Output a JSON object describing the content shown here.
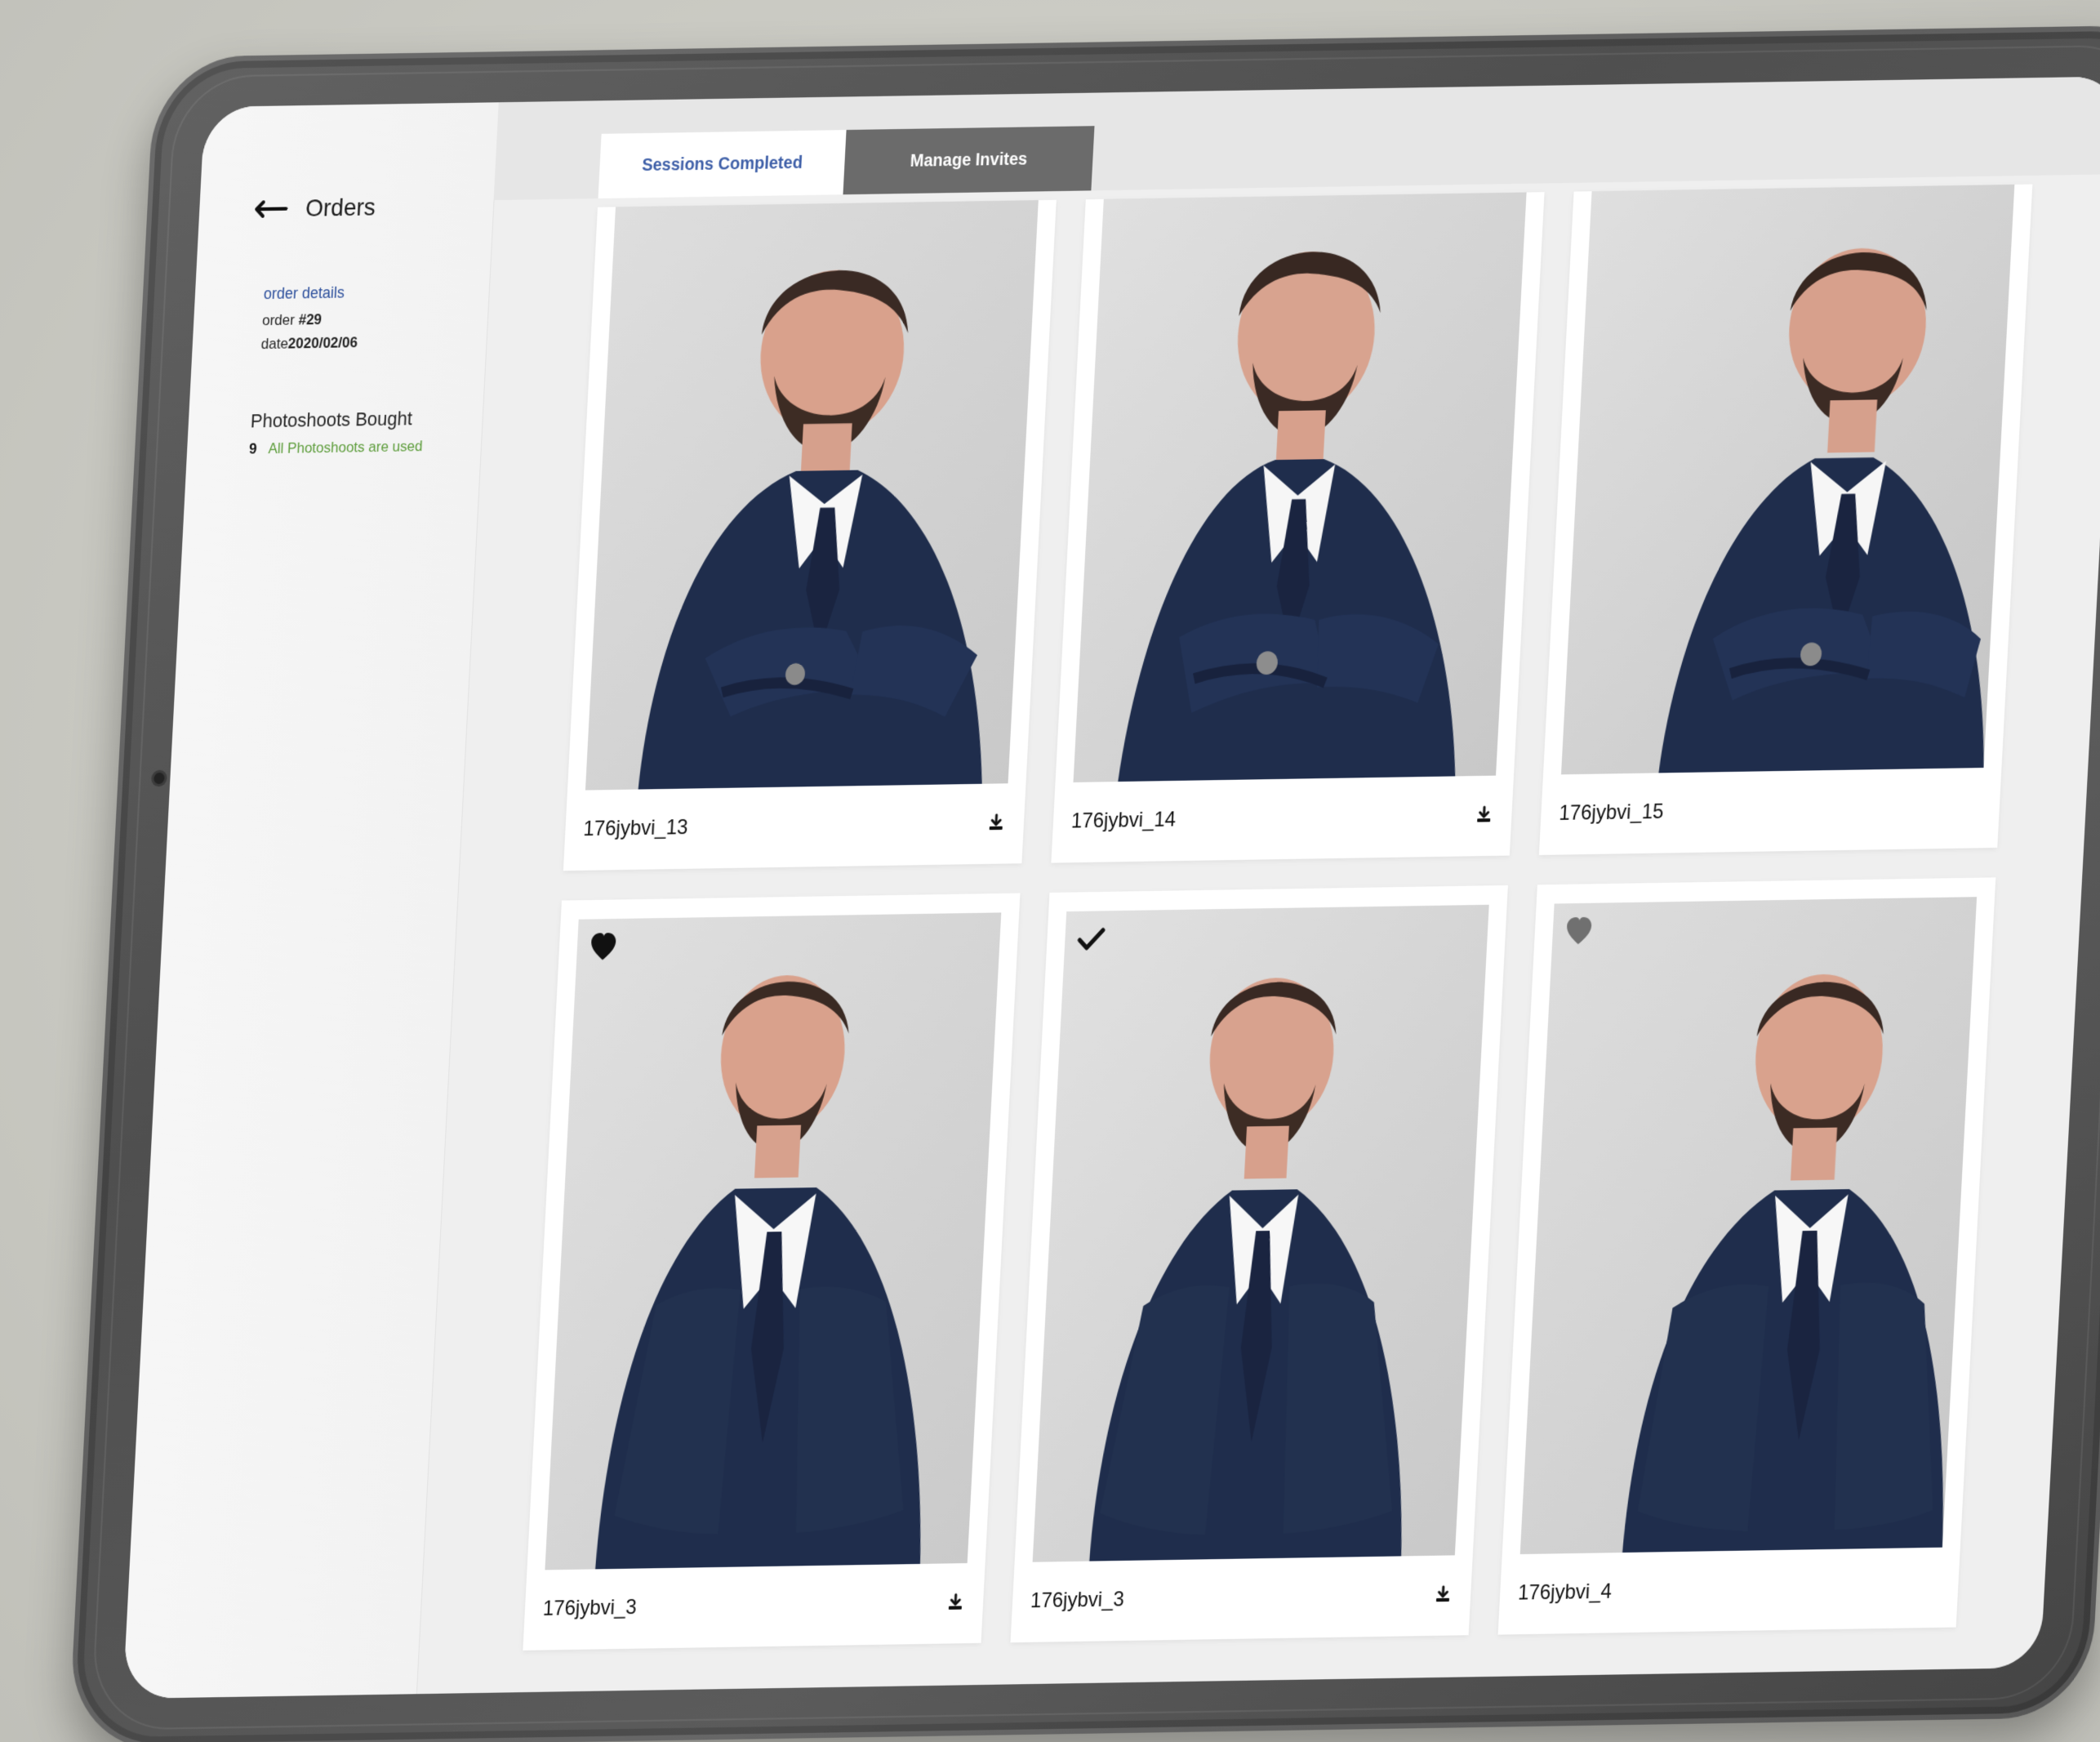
{
  "sidebar": {
    "title": "Orders",
    "back_icon": "arrow-left-icon",
    "order_details_label": "order details",
    "order_label": "order",
    "order_number": "#29",
    "date_label": "date",
    "date_value": "2020/02/06",
    "photoshoots_label": "Photoshoots Bought",
    "photoshoots_count": "9",
    "photoshoots_status": "All Photoshoots are used"
  },
  "tabs": {
    "sessions_completed": "Sessions Completed",
    "manage_invites": "Manage Invites"
  },
  "gallery": {
    "cards": [
      {
        "label": "176jybvi_13",
        "download_icon": "download-icon"
      },
      {
        "label": "176jybvi_14",
        "download_icon": "download-icon"
      },
      {
        "label": "176jybvi_15"
      },
      {
        "label": "176jybvi_3",
        "download_icon": "download-icon",
        "corner_icon": "heart-icon"
      },
      {
        "label": "176jybvi_3",
        "download_icon": "download-icon",
        "corner_icon": "check-icon"
      },
      {
        "label": "176jybvi_4",
        "corner_icon": "heart-icon"
      }
    ]
  },
  "colors": {
    "background": "#cfcfc9",
    "device": "#555555",
    "screen": "#efefef",
    "sidebar": "#f4f4f4",
    "tab_active_text": "#3e5fa8",
    "tab_inactive_bg": "#6b6b6b",
    "status_green": "#5c9c3a",
    "suit_navy": "#1f2d4c"
  }
}
